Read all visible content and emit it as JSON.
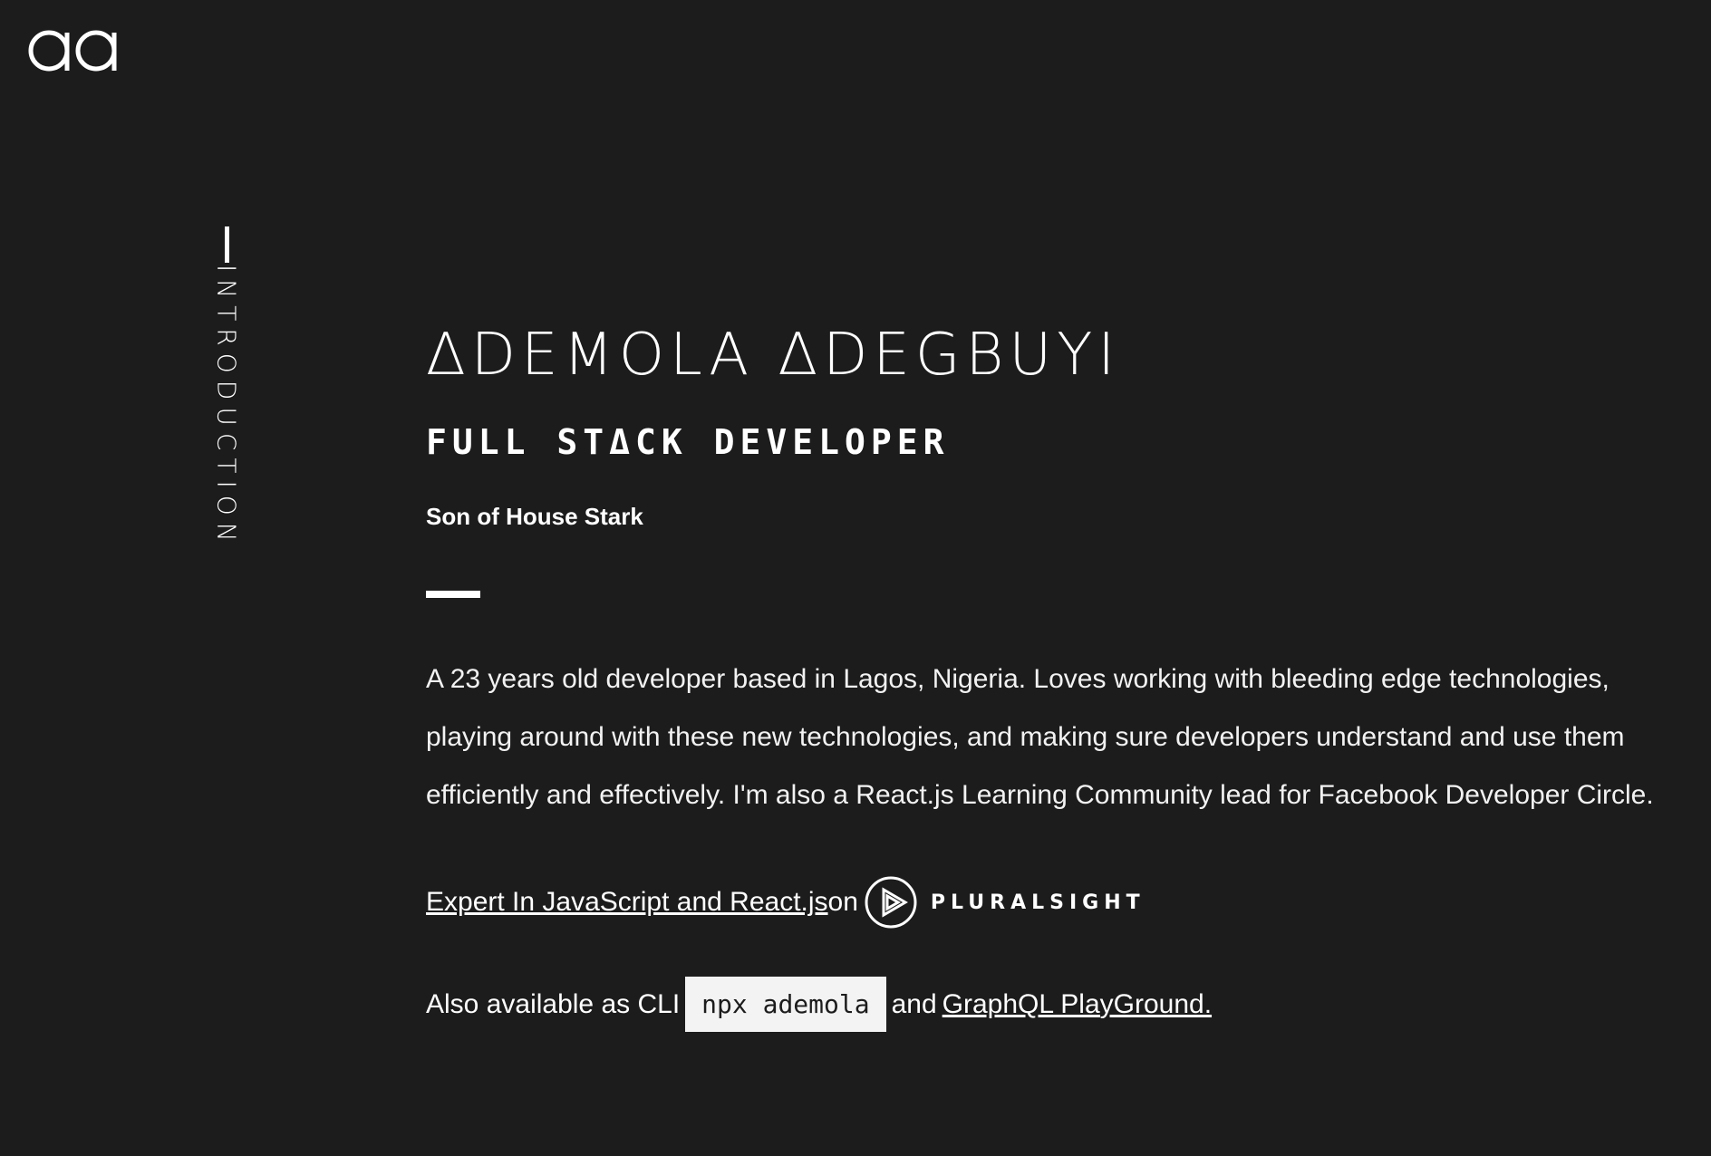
{
  "header": {
    "logo_icon": "aa-monogram-icon"
  },
  "section": {
    "label": "INTRODUCTION"
  },
  "intro": {
    "name": "ΔDEMOLA ΔDEGBUYI",
    "role": "FULL STΔCK DEVELOPER",
    "tagline": "Son of House Stark",
    "bio": "A 23 years old developer based in Lagos, Nigeria. Loves working with bleeding edge technologies, playing around with these new technologies, and making sure developers understand and use them efficiently and effectively. I'm also a React.js Learning Community lead for Facebook Developer Circle.",
    "expert_link": "Expert In JavaScript and React.js",
    "expert_on": "on",
    "pluralsight_label": "PLURALSIGHT",
    "pluralsight_icon": "pluralsight-play-icon",
    "cli_prefix": "Also available as CLI",
    "cli_command": "npx ademola",
    "cli_and": "and",
    "graphql_link": "GraphQL PlayGround."
  },
  "colors": {
    "background": "#1c1c1c",
    "text": "#ffffff",
    "code_background": "#f3f3f3"
  }
}
